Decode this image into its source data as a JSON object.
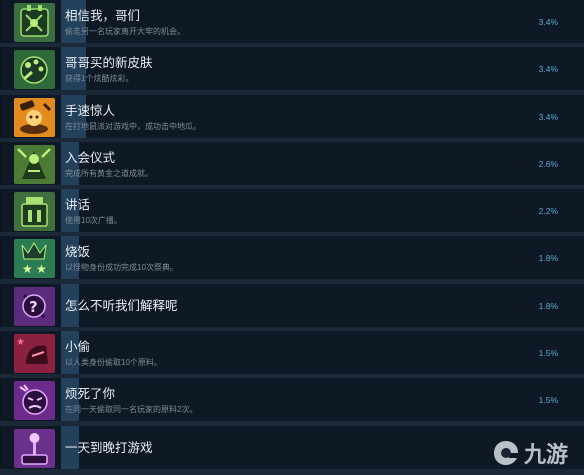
{
  "achievements": [
    {
      "title": "相信我，哥们",
      "desc": "偷走另一名玩家离开大牢的机会。",
      "percent": "3.4%",
      "icon": "cage-icon",
      "color": "#3a6b3f"
    },
    {
      "title": "哥哥买的新皮肤",
      "desc": "获得1个炫酷炫彩。",
      "percent": "3.4%",
      "icon": "palette-icon",
      "color": "#2e6b3a"
    },
    {
      "title": "手速惊人",
      "desc": "在打地鼠派对游戏中，成功击中地瓜。",
      "percent": "3.4%",
      "icon": "whack-mole-icon",
      "color": "#e08a1e"
    },
    {
      "title": "入会仪式",
      "desc": "完成所有黄金之道成就。",
      "percent": "2.6%",
      "icon": "robed-figure-icon",
      "color": "#4b7a35"
    },
    {
      "title": "讲话",
      "desc": "使用10次广播。",
      "percent": "2.2%",
      "icon": "podium-icon",
      "color": "#3d6e3c"
    },
    {
      "title": "烧饭",
      "desc": "以怪物身份成功完成10次祭典。",
      "percent": "1.8%",
      "icon": "monster-stars-icon",
      "color": "#2a7a52"
    },
    {
      "title": "怎么不听我们解释呢",
      "desc": "",
      "percent": "1.8%",
      "icon": "question-bubble-icon",
      "color": "#5b2b7a"
    },
    {
      "title": "小偷",
      "desc": "以人类身份偷取10个原料。",
      "percent": "1.5%",
      "icon": "thief-icon",
      "color": "#8a2040"
    },
    {
      "title": "烦死了你",
      "desc": "在同一天偷取同一名玩家的原料2次。",
      "percent": "1.5%",
      "icon": "angry-face-icon",
      "color": "#6b2a8a"
    },
    {
      "title": "一天到晚打游戏",
      "desc": "",
      "percent": "",
      "icon": "joystick-icon",
      "color": "#6a2f8a"
    }
  ],
  "watermark": {
    "text": "九游"
  }
}
